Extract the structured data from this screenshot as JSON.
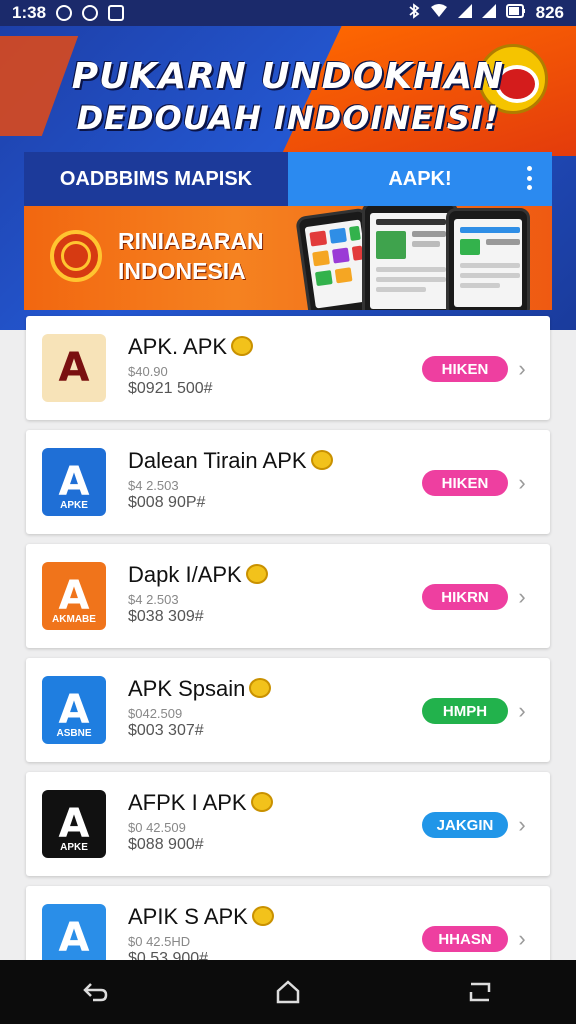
{
  "status_bar": {
    "time": "1:38",
    "right_text": "826",
    "icons": [
      "circle-badge-icon",
      "square-badge-icon",
      "qr-icon",
      "bluetooth-icon",
      "wifi-icon",
      "signal-icon",
      "signal-icon",
      "battery-icon"
    ]
  },
  "header": {
    "headline_line1": "PUKARN UNDOKHAN",
    "headline_line2": "DEDOUAH INDOINEISI!",
    "tabs": [
      {
        "label": "OADBBIMS MAPISK",
        "active": false
      },
      {
        "label": "AAPK!",
        "active": true
      }
    ],
    "menu_icon": "more-vert-icon"
  },
  "banner": {
    "line1": "RINIABARAN",
    "line2": "INDONESIA"
  },
  "apps": [
    {
      "name": "APK. APK",
      "meta1": "$40.90",
      "meta2": "$0921 500#",
      "button": "HIKEN",
      "button_color": "#ee3fa0",
      "icon_bg": "#f7e3b8",
      "icon_fg": "#7a1010",
      "icon_sub": "",
      "icon_sub_color": "#7a1010"
    },
    {
      "name": "Dalean Tirain APK",
      "meta1": "$4 2.503",
      "meta2": "$008 90P#",
      "button": "HIKEN",
      "button_color": "#ee3fa0",
      "icon_bg": "#1f6fd6",
      "icon_fg": "#ffffff",
      "icon_sub": "APKE",
      "icon_sub_color": "#ffffff"
    },
    {
      "name": "Dapk I/APK",
      "meta1": "$4 2.503",
      "meta2": "$038 309#",
      "button": "HIKRN",
      "button_color": "#ee3fa0",
      "icon_bg": "#f0741b",
      "icon_fg": "#ffffff",
      "icon_sub": "AKMABE",
      "icon_sub_color": "#ffffff"
    },
    {
      "name": "APK Spsain",
      "meta1": "$042.509",
      "meta2": "$003 307#",
      "button": "HMPH",
      "button_color": "#22b24c",
      "icon_bg": "#1f7ee0",
      "icon_fg": "#ffffff",
      "icon_sub": "ASBNE",
      "icon_sub_color": "#ffffff"
    },
    {
      "name": "AFPK I APK",
      "meta1": "$0 42.509",
      "meta2": "$088 900#",
      "button": "JAKGIN",
      "button_color": "#2196e8",
      "icon_bg": "#111111",
      "icon_fg": "#ffffff",
      "icon_sub": "APKE",
      "icon_sub_color": "#ffffff"
    },
    {
      "name": "APIK S APK",
      "meta1": "$0 42.5HD",
      "meta2": "$0 53 900#",
      "button": "HHASN",
      "button_color": "#ee3fa0",
      "icon_bg": "#2a8ee8",
      "icon_fg": "#ffffff",
      "icon_sub": "",
      "icon_sub_color": "#ffffff"
    }
  ],
  "nav": {
    "back": "back-icon",
    "home": "home-icon",
    "recents": "recents-icon"
  }
}
